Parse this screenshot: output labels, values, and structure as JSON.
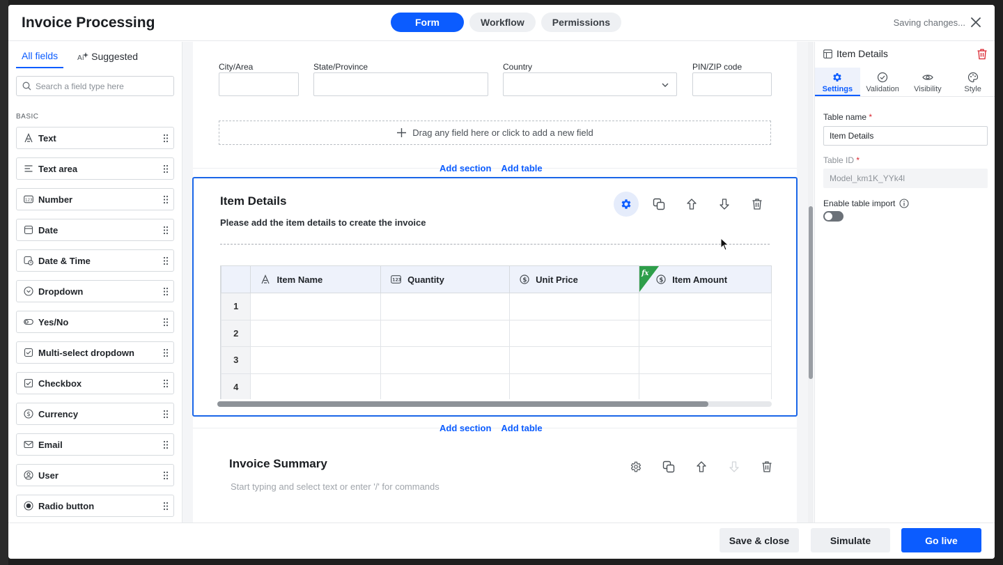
{
  "header": {
    "title": "Invoice Processing",
    "tabs": [
      {
        "label": "Form",
        "active": true
      },
      {
        "label": "Workflow",
        "active": false
      },
      {
        "label": "Permissions",
        "active": false
      }
    ],
    "status": "Saving changes..."
  },
  "left_panel": {
    "tabs": [
      {
        "label": "All fields",
        "active": true
      },
      {
        "label": "Suggested",
        "active": false
      }
    ],
    "search_placeholder": "Search a field type here",
    "section_label": "BASIC",
    "fields": [
      {
        "label": "Text",
        "icon": "text-icon"
      },
      {
        "label": "Text area",
        "icon": "text-area-icon"
      },
      {
        "label": "Number",
        "icon": "number-icon"
      },
      {
        "label": "Date",
        "icon": "date-icon"
      },
      {
        "label": "Date & Time",
        "icon": "date-time-icon"
      },
      {
        "label": "Dropdown",
        "icon": "dropdown-icon"
      },
      {
        "label": "Yes/No",
        "icon": "toggle-icon"
      },
      {
        "label": "Multi-select dropdown",
        "icon": "multi-select-icon"
      },
      {
        "label": "Checkbox",
        "icon": "checkbox-icon"
      },
      {
        "label": "Currency",
        "icon": "currency-icon"
      },
      {
        "label": "Email",
        "icon": "email-icon"
      },
      {
        "label": "User",
        "icon": "user-icon"
      },
      {
        "label": "Radio button",
        "icon": "radio-icon"
      }
    ]
  },
  "canvas": {
    "address_fields": {
      "city": "City/Area",
      "state": "State/Province",
      "country": "Country",
      "zip": "PIN/ZIP code"
    },
    "drop_zone": "Drag any field here or click to add a new field",
    "add_section": "Add section",
    "add_table": "Add table",
    "item_section": {
      "title": "Item Details",
      "description": "Please add the item details to create the invoice",
      "columns": [
        {
          "label": "Item Name",
          "icon": "text-icon"
        },
        {
          "label": "Quantity",
          "icon": "number-icon"
        },
        {
          "label": "Unit Price",
          "icon": "currency-icon"
        },
        {
          "label": "Item Amount",
          "icon": "currency-icon",
          "formula": true
        }
      ],
      "formula_badge": "fx",
      "rows": [
        "1",
        "2",
        "3",
        "4"
      ]
    },
    "summary_section": {
      "title": "Invoice Summary",
      "placeholder": "Start typing and select text or enter '/' for commands"
    }
  },
  "right_panel": {
    "title": "Item Details",
    "tabs": [
      {
        "label": "Settings",
        "icon": "gear-icon",
        "active": true
      },
      {
        "label": "Validation",
        "icon": "check-circle-icon",
        "active": false
      },
      {
        "label": "Visibility",
        "icon": "eye-icon",
        "active": false
      },
      {
        "label": "Style",
        "icon": "palette-icon",
        "active": false
      }
    ],
    "table_name_label": "Table name",
    "table_name_value": "Item Details",
    "table_id_label": "Table ID",
    "table_id_value": "Model_km1K_YYk4l",
    "enable_import_label": "Enable table import",
    "enable_import_on": false,
    "required_mark": "*"
  },
  "footer": {
    "save_close": "Save & close",
    "simulate": "Simulate",
    "go_live": "Go live"
  },
  "colors": {
    "accent": "#0b5cff",
    "formula_badge": "#2e9e4a",
    "danger": "#d9232d"
  }
}
